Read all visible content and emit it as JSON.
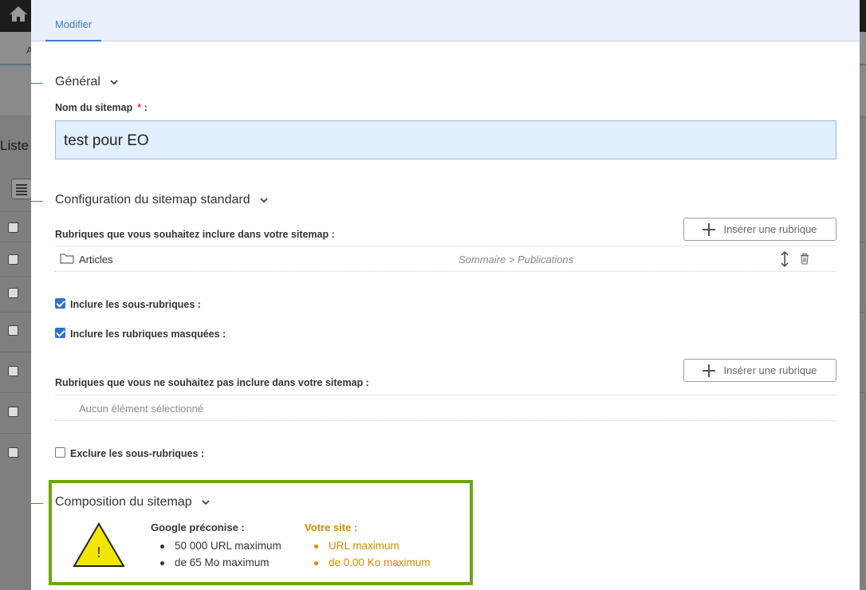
{
  "background": {
    "partial_label": "Liste",
    "subbar_letter": "A"
  },
  "modal": {
    "tab_label": "Modifier",
    "sections": {
      "general": {
        "title": "Général",
        "name_label": "Nom du sitemap",
        "name_required_mark": "*",
        "name_suffix": " :",
        "name_value": "test pour EO"
      },
      "config": {
        "title": "Configuration du sitemap standard",
        "include_label": "Rubriques que vous souhaitez inclure dans votre sitemap :",
        "insert_button": "Insérer une rubrique",
        "included_items": [
          {
            "label": "Articles",
            "path": "Sommaire > Publications"
          }
        ],
        "include_subsections": {
          "label": "Inclure les sous-rubriques :",
          "checked": true
        },
        "include_hidden": {
          "label": "Inclure les rubriques masquées :",
          "checked": true
        },
        "exclude_label": "Rubriques que vous ne souhaitez pas inclure dans votre sitemap :",
        "exclude_insert_button": "Insérer une rubrique",
        "exclude_empty": "Aucun élément sélectionné",
        "exclude_subsections": {
          "label": "Exclure les sous-rubriques :",
          "checked": false
        }
      },
      "composition": {
        "title": "Composition du sitemap",
        "warning_symbol": "!",
        "google_title": "Google préconise :",
        "google_items": [
          "50 000 URL maximum",
          "de 65 Mo maximum"
        ],
        "site_title": "Votre site :",
        "site_items": [
          "URL maximum",
          "de 0.00 Ko maximum"
        ]
      }
    }
  },
  "colors": {
    "accent": "#3c7cc1",
    "header_bg": "#e9f0fb",
    "input_bg": "#e2efff",
    "highlight_border": "#6ea50e",
    "warning_fill": "#f2e600",
    "site_text": "#d68a00"
  }
}
